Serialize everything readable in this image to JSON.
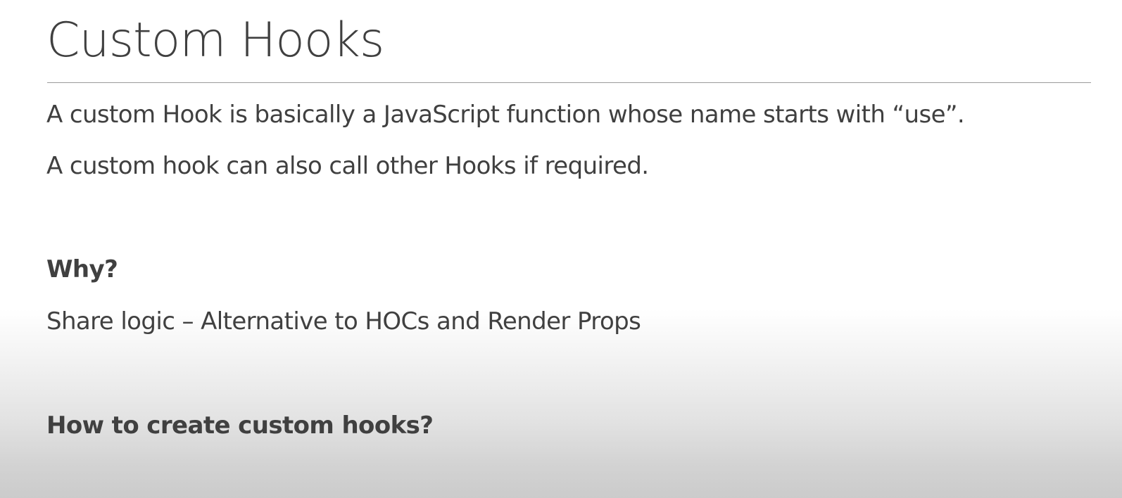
{
  "slide": {
    "title": "Custom Hooks",
    "lines": [
      "A custom Hook is basically a JavaScript function whose name starts with “use”.",
      "A custom hook can also call other Hooks if required.",
      "Why?",
      "Share logic – Alternative to HOCs and Render Props",
      "How to create custom hooks?"
    ]
  }
}
